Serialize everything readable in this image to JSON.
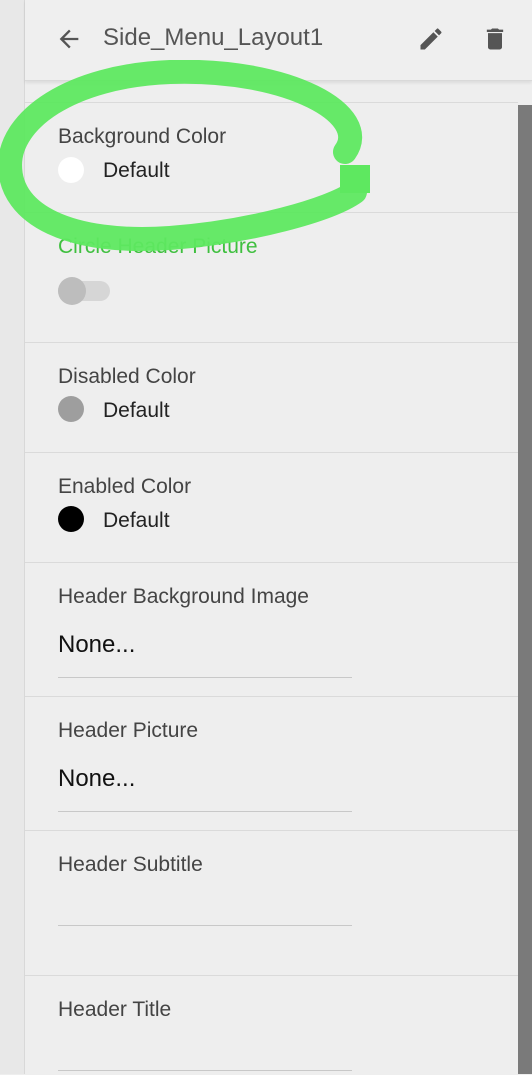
{
  "header": {
    "title": "Side_Menu_Layout1",
    "back_icon": "arrow-back-icon",
    "edit_icon": "pencil-icon",
    "delete_icon": "trash-icon"
  },
  "properties": {
    "background_color": {
      "label": "Background Color",
      "value": "Default",
      "swatch": "#ffffff"
    },
    "circle_header_picture": {
      "label": "Circle Header Picture",
      "enabled": false
    },
    "disabled_color": {
      "label": "Disabled Color",
      "value": "Default",
      "swatch": "#9e9e9e"
    },
    "enabled_color": {
      "label": "Enabled Color",
      "value": "Default",
      "swatch": "#000000"
    },
    "header_background_image": {
      "label": "Header Background Image",
      "value": "None..."
    },
    "header_picture": {
      "label": "Header Picture",
      "value": "None..."
    },
    "header_subtitle": {
      "label": "Header Subtitle",
      "value": ""
    },
    "header_title": {
      "label": "Header Title",
      "value": ""
    }
  },
  "annotation_color": "#5ee860"
}
